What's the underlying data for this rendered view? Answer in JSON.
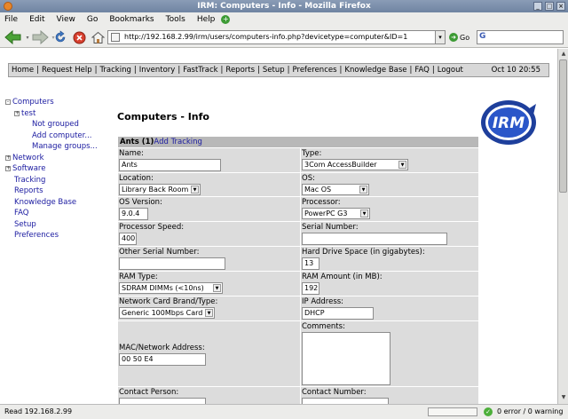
{
  "window": {
    "title": "IRM: Computers - Info - Mozilla Firefox"
  },
  "menubar": [
    "File",
    "Edit",
    "View",
    "Go",
    "Bookmarks",
    "Tools",
    "Help"
  ],
  "url": "http://192.168.2.99/irm/users/computers-info.php?devicetype=computer&ID=1",
  "go_label": "Go",
  "nav": {
    "links": [
      "Home",
      "Request Help",
      "Tracking",
      "Inventory",
      "FastTrack",
      "Reports",
      "Setup",
      "Preferences",
      "Knowledge Base",
      "FAQ",
      "Logout"
    ],
    "date": "Oct 10 20:55"
  },
  "tree": [
    {
      "label": "Computers",
      "level": 0,
      "toggle": "−"
    },
    {
      "label": "test",
      "level": 1,
      "toggle": "+"
    },
    {
      "label": "Not grouped",
      "level": 2,
      "toggle": ""
    },
    {
      "label": "Add computer...",
      "level": 2,
      "toggle": ""
    },
    {
      "label": "Manage groups...",
      "level": 2,
      "toggle": ""
    },
    {
      "label": "Network",
      "level": 0,
      "toggle": "+"
    },
    {
      "label": "Software",
      "level": 0,
      "toggle": "+"
    },
    {
      "label": "Tracking",
      "level": 0,
      "toggle": ""
    },
    {
      "label": "Reports",
      "level": 0,
      "toggle": ""
    },
    {
      "label": "Knowledge Base",
      "level": 0,
      "toggle": ""
    },
    {
      "label": "FAQ",
      "level": 0,
      "toggle": ""
    },
    {
      "label": "Setup",
      "level": 0,
      "toggle": ""
    },
    {
      "label": "Preferences",
      "level": 0,
      "toggle": ""
    }
  ],
  "page_title": "Computers - Info",
  "logo_text": "IRM",
  "form": {
    "header_name": "Ants (1)",
    "header_link": "Add Tracking",
    "rows": [
      [
        {
          "label": "Name:",
          "type": "input",
          "value": "Ants",
          "w": 115
        },
        {
          "label": "Type:",
          "type": "select",
          "value": "3Com AccessBuilder",
          "w": 120
        }
      ],
      [
        {
          "label": "Location:",
          "type": "select",
          "value": "Library Back Room",
          "w": 92
        },
        {
          "label": "OS:",
          "type": "select",
          "value": "Mac OS",
          "w": 76
        }
      ],
      [
        {
          "label": "OS Version:",
          "type": "input",
          "value": "9.0.4",
          "w": 33
        },
        {
          "label": "Processor:",
          "type": "select",
          "value": "PowerPC G3",
          "w": 77
        }
      ],
      [
        {
          "label": "Processor Speed:",
          "type": "input",
          "value": "400",
          "w": 20
        },
        {
          "label": "Serial Number:",
          "type": "input",
          "value": "",
          "w": 164
        }
      ],
      [
        {
          "label": "Other Serial Number:",
          "type": "input",
          "value": "",
          "w": 120
        },
        {
          "label": "Hard Drive Space (in gigabytes):",
          "type": "input",
          "value": "13",
          "w": 20
        }
      ],
      [
        {
          "label": "RAM Type:",
          "type": "select",
          "value": "SDRAM DIMMs (<10ns)",
          "w": 117
        },
        {
          "label": "RAM Amount (in MB):",
          "type": "input",
          "value": "192",
          "w": 20
        }
      ],
      [
        {
          "label": "Network Card Brand/Type:",
          "type": "select",
          "value": "Generic 100Mbps Card",
          "w": 108
        },
        {
          "label": "IP Address:",
          "type": "input",
          "value": "DHCP",
          "w": 81
        }
      ],
      [
        {
          "label": "MAC/Network Address:",
          "type": "input",
          "value": "00 50 E4",
          "w": 98,
          "tall": true
        },
        {
          "label": "Comments:",
          "type": "textarea",
          "value": "",
          "w": 100
        }
      ],
      [
        {
          "label": "Contact Person:",
          "type": "input",
          "value": "",
          "w": 98
        },
        {
          "label": "Contact Number:",
          "type": "input",
          "value": "",
          "w": 98
        }
      ]
    ]
  },
  "status": {
    "text": "Read 192.168.2.99",
    "errors": "0 error / 0 warning"
  }
}
